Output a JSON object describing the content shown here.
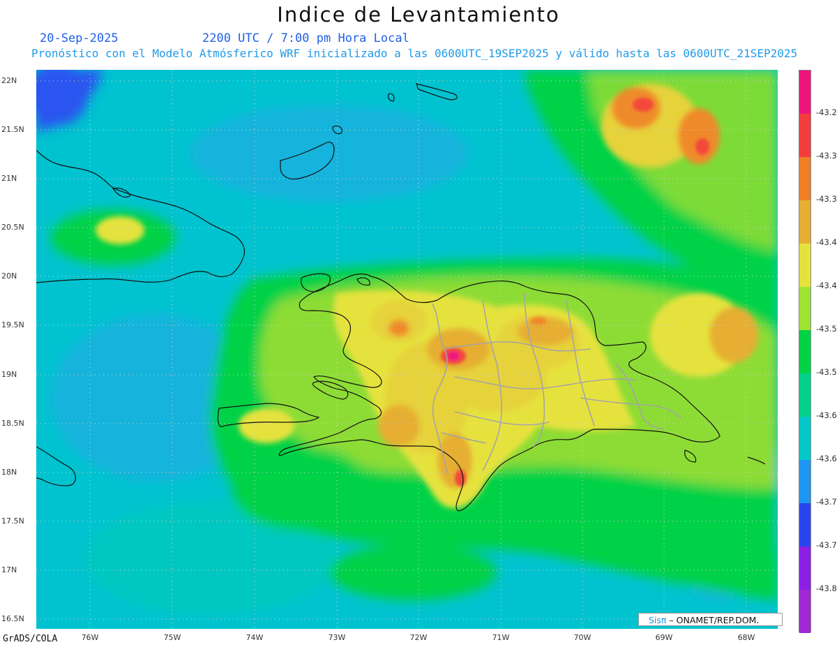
{
  "header": {
    "title": "Indice de Levantamiento",
    "date": "20-Sep-2025",
    "time": "2200 UTC / 7:00 pm Hora Local",
    "forecast": "Pronóstico con el Modelo Atmósferico WRF inicializado a las 0600UTC_19SEP2025 y válido hasta las  0600UTC_21SEP2025"
  },
  "map": {
    "lat_labels": [
      "22N",
      "21.5N",
      "21N",
      "20.5N",
      "20N",
      "19.5N",
      "19N",
      "18.5N",
      "18N",
      "17.5N",
      "17N",
      "16.5N"
    ],
    "lon_labels": [
      "76W",
      "75W",
      "74W",
      "73W",
      "72W",
      "71W",
      "70W",
      "69W",
      "68W"
    ],
    "colors": {
      "ocean_main": "#00c7c3",
      "ocean_light": "#00bfd6",
      "blue": "#1e7cf5",
      "green": "#00d246",
      "light_green": "#a0e232",
      "yellow": "#e6e23c",
      "orange_yellow": "#e6b030",
      "orange": "#ef8a2a",
      "red": "#f24a3a",
      "magenta": "#f0147f"
    }
  },
  "colorbar": {
    "labels": [
      "-43.2",
      "-43.3",
      "-43.3",
      "-43.4",
      "-43.4",
      "-43.5",
      "-43.5",
      "-43.6",
      "-43.6",
      "-43.7",
      "-43.7",
      "-43.8"
    ],
    "colors": [
      "#f0147f",
      "#f43c3c",
      "#ef7f26",
      "#e6ae32",
      "#e6e23c",
      "#a0e232",
      "#00d246",
      "#00d28a",
      "#00c8c8",
      "#1e96f0",
      "#2846f0",
      "#8c1ee6",
      "#a028d2"
    ]
  },
  "footer": {
    "credit": "GrADS/COLA",
    "badge_prefix": "Sisπ",
    "badge_text": " – ONAMET/REP.DOM."
  }
}
